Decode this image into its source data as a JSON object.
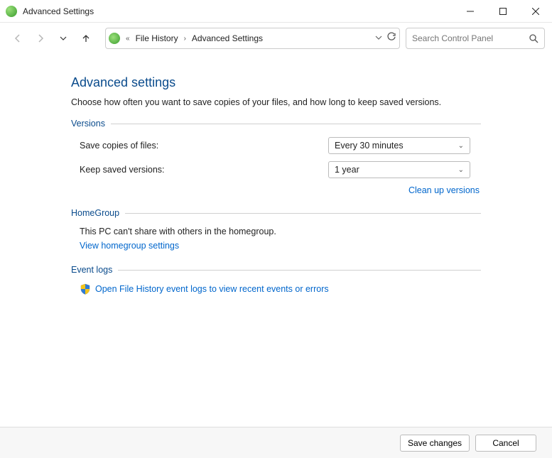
{
  "window": {
    "title": "Advanced Settings"
  },
  "breadcrumb": {
    "item1": "File History",
    "item2": "Advanced Settings"
  },
  "search": {
    "placeholder": "Search Control Panel"
  },
  "page": {
    "heading": "Advanced settings",
    "intro": "Choose how often you want to save copies of your files, and how long to keep saved versions."
  },
  "sections": {
    "versions": {
      "title": "Versions",
      "save_label": "Save copies of files:",
      "save_value": "Every 30 minutes",
      "keep_label": "Keep saved versions:",
      "keep_value": "1 year",
      "cleanup_link": "Clean up versions"
    },
    "homegroup": {
      "title": "HomeGroup",
      "text": "This PC can't share with others in the homegroup.",
      "link": "View homegroup settings"
    },
    "eventlogs": {
      "title": "Event logs",
      "link": "Open File History event logs to view recent events or errors"
    }
  },
  "footer": {
    "save": "Save changes",
    "cancel": "Cancel"
  }
}
